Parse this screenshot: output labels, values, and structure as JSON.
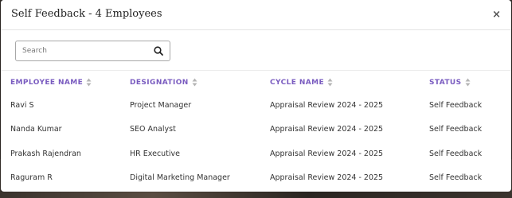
{
  "modal": {
    "title": "Self Feedback - 4 Employees",
    "close_label": "×"
  },
  "search": {
    "placeholder": "Search",
    "value": "",
    "icon": "search-icon"
  },
  "table": {
    "columns": [
      {
        "label": "EMPLOYEE NAME",
        "sortable": true
      },
      {
        "label": "DESIGNATION",
        "sortable": true
      },
      {
        "label": "CYCLE NAME",
        "sortable": true
      },
      {
        "label": "STATUS",
        "sortable": true
      }
    ],
    "rows": [
      {
        "name": "Ravi S",
        "designation": "Project Manager",
        "cycle": "Appraisal Review 2024 - 2025",
        "status": "Self Feedback"
      },
      {
        "name": "Nanda Kumar",
        "designation": "SEO Analyst",
        "cycle": "Appraisal Review 2024 - 2025",
        "status": "Self Feedback"
      },
      {
        "name": "Prakash Rajendran",
        "designation": "HR Executive",
        "cycle": "Appraisal Review 2024 - 2025",
        "status": "Self Feedback"
      },
      {
        "name": "Raguram R",
        "designation": "Digital Marketing Manager",
        "cycle": "Appraisal Review 2024 - 2025",
        "status": "Self Feedback"
      }
    ]
  },
  "colors": {
    "header_text": "#7a5cc0",
    "body_text": "#333333"
  }
}
